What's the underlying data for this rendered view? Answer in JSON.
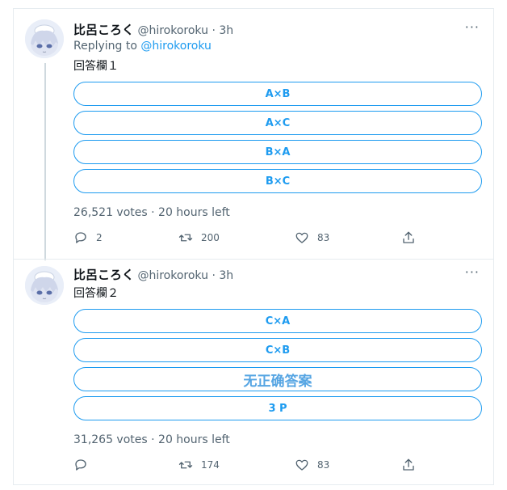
{
  "tweets": [
    {
      "name": "比呂ころく",
      "handle": "@hirokoroku",
      "dot": "·",
      "time": "3h",
      "more": "···",
      "replying_prefix": "Replying to ",
      "replying_handle": "@hirokoroku",
      "text": "回答欄１",
      "choices": [
        "A×B",
        "A×C",
        "B×A",
        "B×C"
      ],
      "votes": "26,521 votes · 20 hours left",
      "actions": {
        "reply": "2",
        "retweet": "200",
        "like": "83"
      }
    },
    {
      "name": "比呂ころく",
      "handle": "@hirokoroku",
      "dot": "·",
      "time": "3h",
      "more": "···",
      "text": "回答欄２",
      "choices": [
        "C×A",
        "C×B",
        "无正确答案",
        "3 P"
      ],
      "votes": "31,265 votes · 20 hours left",
      "actions": {
        "reply": "",
        "retweet": "174",
        "like": "83"
      }
    }
  ],
  "icons": [
    "reply-icon",
    "retweet-icon",
    "like-icon",
    "share-icon",
    "more-icon"
  ],
  "colors": {
    "accent": "#1d9bf0",
    "muted": "#536471",
    "border": "#e6ecf0"
  }
}
